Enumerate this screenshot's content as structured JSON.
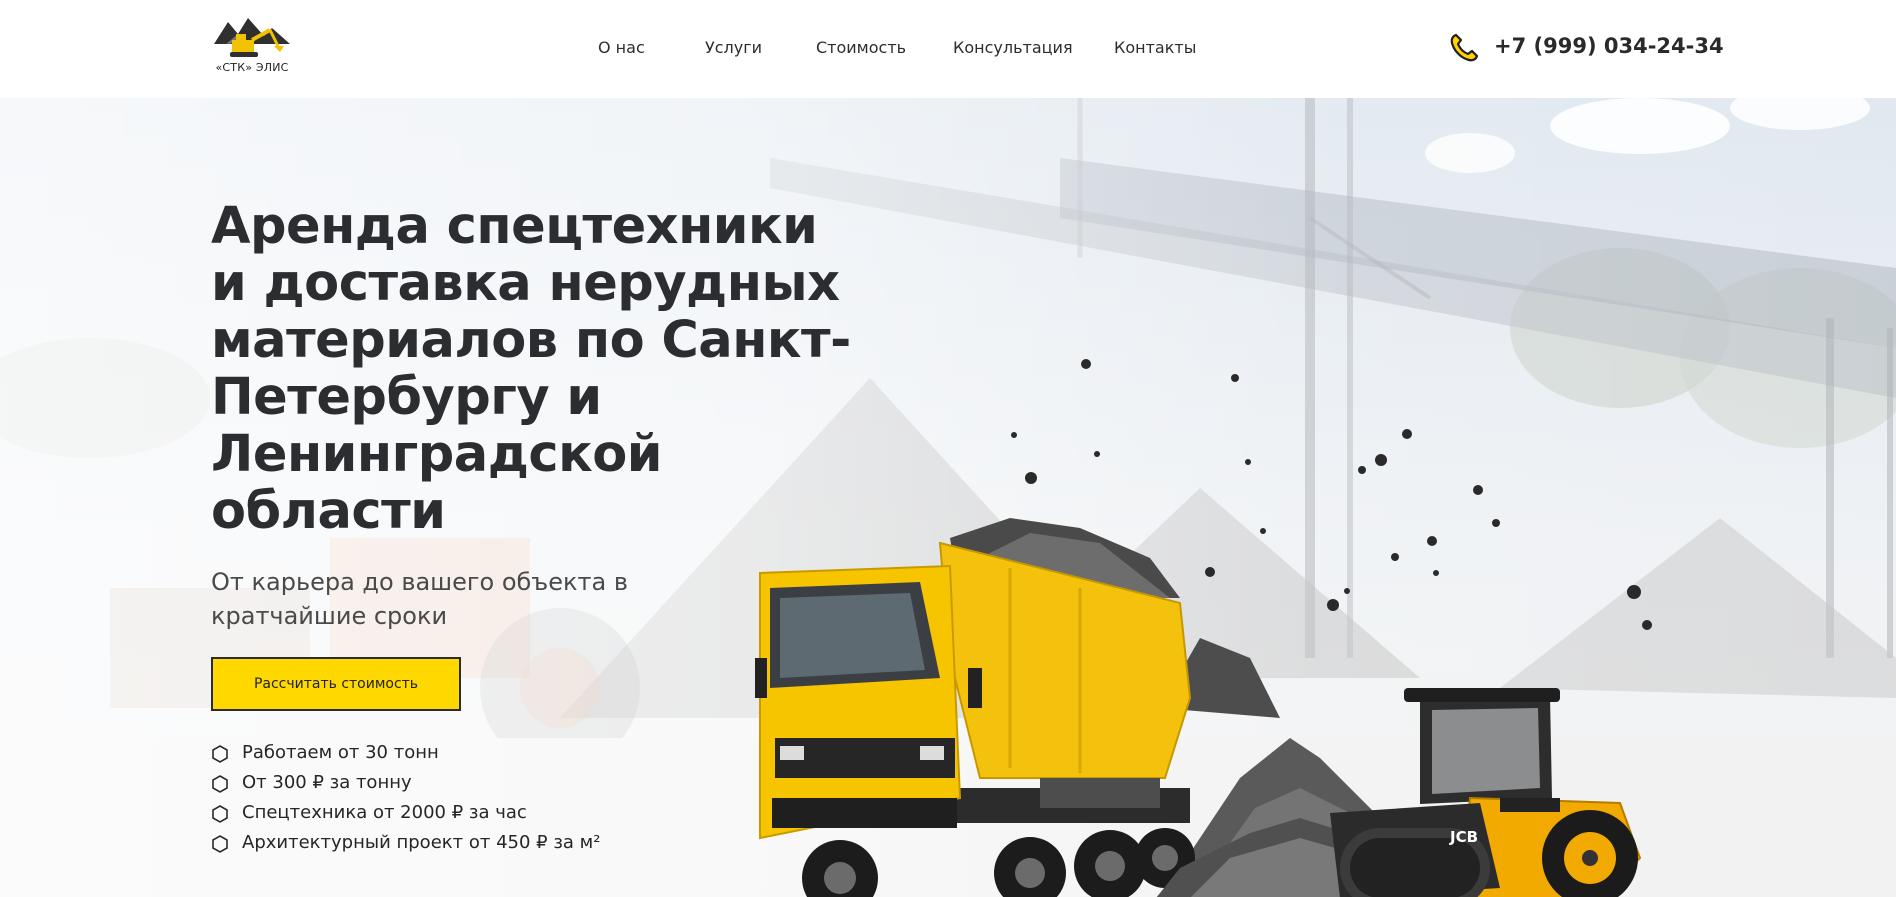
{
  "header": {
    "logo_text": "«СТК» ЭЛИС",
    "nav": [
      {
        "label": "О нас"
      },
      {
        "label": "Услуги"
      },
      {
        "label": "Стоимость"
      },
      {
        "label": "Консультация"
      },
      {
        "label": "Контакты"
      }
    ],
    "phone": "+7 (999) 034-24-34",
    "icons": {
      "phone": "phone-icon",
      "logo": "excavator-mountain-logo"
    }
  },
  "hero": {
    "title": "Аренда спецтехники и доставка нерудных материалов по Санкт-Петербургу и Ленинградской области",
    "subtitle": "От карьера до вашего объекта в кратчайшие сроки",
    "cta_label": "Рассчитать стоимость",
    "features": [
      "Работаем от 30 тонн",
      "От 300 ₽ за тонну",
      "Спецтехника от 2000 ₽ за час",
      "Архитектурный проект от 450 ₽ за м²"
    ],
    "vehicle_labels": {
      "roller_brand": "JCB"
    }
  },
  "colors": {
    "accent": "#ffd800",
    "text_dark": "#2b2d31",
    "border": "#2b2b2b"
  }
}
